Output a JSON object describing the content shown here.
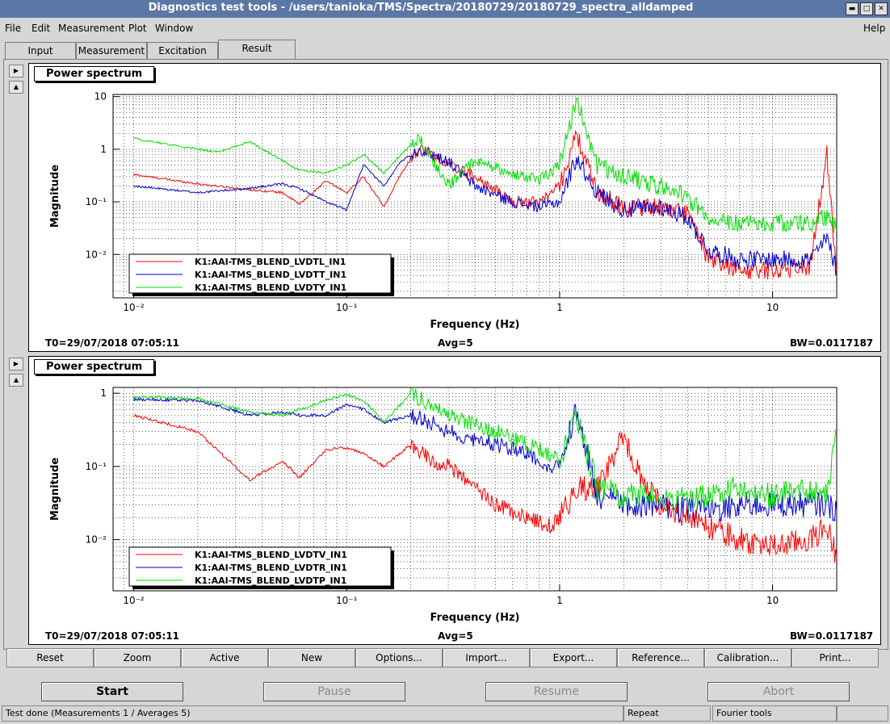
{
  "window": {
    "title": "Diagnostics test tools - /users/tanioka/TMS/Spectra/20180729/20180729_spectra_alldamped"
  },
  "menu": {
    "file": "File",
    "edit": "Edit",
    "measurement": "Measurement",
    "plot": "Plot",
    "window": "Window",
    "help": "Help"
  },
  "tabs": {
    "input": "Input",
    "measurement": "Measurement",
    "excitation": "Excitation",
    "result": "Result"
  },
  "colors": {
    "red": "#ff0000",
    "blue": "#0000cc",
    "green": "#00e000",
    "titlebar": "#5b77a6"
  },
  "panels": [
    {
      "title": "Power spectrum",
      "t0": "T0=29/07/2018 07:05:11",
      "avg": "Avg=5",
      "bw": "BW=0.0117187",
      "ylabel": "Magnitude",
      "xlabel": "Frequency (Hz)",
      "xticks": [
        "10⁻²",
        "10⁻¹",
        "1",
        "10"
      ],
      "yticks": [
        "10",
        "1",
        "10⁻¹",
        "10⁻²"
      ],
      "legend": [
        "K1:AAI-TMS_BLEND_LVDTL_IN1",
        "K1:AAI-TMS_BLEND_LVDTT_IN1",
        "K1:AAI-TMS_BLEND_LVDTY_IN1"
      ]
    },
    {
      "title": "Power spectrum",
      "t0": "T0=29/07/2018 07:05:11",
      "avg": "Avg=5",
      "bw": "BW=0.0117187",
      "ylabel": "Magnitude",
      "xlabel": "Frequency (Hz)",
      "xticks": [
        "10⁻²",
        "10⁻¹",
        "1",
        "10"
      ],
      "yticks": [
        "1",
        "10⁻¹",
        "10⁻²"
      ],
      "legend": [
        "K1:AAI-TMS_BLEND_LVDTV_IN1",
        "K1:AAI-TMS_BLEND_LVDTR_IN1",
        "K1:AAI-TMS_BLEND_LVDTP_IN1"
      ]
    }
  ],
  "chart_data": [
    {
      "type": "line",
      "title": "Power spectrum",
      "xlabel": "Frequency (Hz)",
      "ylabel": "Magnitude",
      "xscale": "log",
      "yscale": "log",
      "xlim": [
        0.008,
        20
      ],
      "ylim": [
        0.0015,
        11
      ],
      "grid": true,
      "legend_position": "bottom-left",
      "series": [
        {
          "name": "K1:AAI-TMS_BLEND_LVDTL_IN1",
          "color": "#ff0000",
          "x": [
            0.01,
            0.02,
            0.035,
            0.05,
            0.06,
            0.08,
            0.1,
            0.12,
            0.15,
            0.18,
            0.22,
            0.3,
            0.4,
            0.6,
            0.8,
            1.0,
            1.2,
            1.5,
            2,
            3,
            4,
            5,
            7,
            10,
            15,
            18,
            20
          ],
          "y": [
            0.33,
            0.22,
            0.17,
            0.15,
            0.09,
            0.25,
            0.15,
            0.3,
            0.08,
            0.35,
            1.1,
            0.5,
            0.3,
            0.1,
            0.1,
            0.2,
            1.9,
            0.15,
            0.08,
            0.08,
            0.06,
            0.008,
            0.005,
            0.005,
            0.006,
            0.8,
            0.004
          ]
        },
        {
          "name": "K1:AAI-TMS_BLEND_LVDTT_IN1",
          "color": "#0000cc",
          "x": [
            0.01,
            0.02,
            0.035,
            0.05,
            0.06,
            0.08,
            0.1,
            0.12,
            0.15,
            0.18,
            0.22,
            0.3,
            0.4,
            0.6,
            0.8,
            1.0,
            1.2,
            1.5,
            2,
            3,
            4,
            5,
            7,
            10,
            15,
            18,
            20
          ],
          "y": [
            0.2,
            0.15,
            0.18,
            0.22,
            0.18,
            0.1,
            0.07,
            0.5,
            0.2,
            0.6,
            1.0,
            0.6,
            0.2,
            0.1,
            0.08,
            0.1,
            0.7,
            0.15,
            0.07,
            0.08,
            0.05,
            0.012,
            0.008,
            0.008,
            0.008,
            0.02,
            0.005
          ]
        },
        {
          "name": "K1:AAI-TMS_BLEND_LVDTY_IN1",
          "color": "#00e000",
          "x": [
            0.01,
            0.02,
            0.025,
            0.035,
            0.05,
            0.06,
            0.08,
            0.1,
            0.12,
            0.15,
            0.18,
            0.22,
            0.3,
            0.4,
            0.6,
            0.8,
            1.0,
            1.2,
            1.5,
            2,
            3,
            4,
            5,
            7,
            10,
            15,
            18,
            20
          ],
          "y": [
            1.6,
            1.0,
            0.9,
            1.4,
            0.6,
            0.4,
            0.35,
            0.5,
            0.8,
            0.35,
            0.8,
            1.6,
            0.2,
            0.6,
            0.35,
            0.25,
            0.5,
            9.0,
            0.5,
            0.3,
            0.2,
            0.12,
            0.05,
            0.04,
            0.04,
            0.04,
            0.05,
            0.03
          ]
        }
      ]
    },
    {
      "type": "line",
      "title": "Power spectrum",
      "xlabel": "Frequency (Hz)",
      "ylabel": "Magnitude",
      "xscale": "log",
      "yscale": "log",
      "xlim": [
        0.008,
        20
      ],
      "ylim": [
        0.002,
        1.2
      ],
      "grid": true,
      "legend_position": "bottom-left",
      "series": [
        {
          "name": "K1:AAI-TMS_BLEND_LVDTV_IN1",
          "color": "#ff0000",
          "x": [
            0.01,
            0.02,
            0.035,
            0.05,
            0.06,
            0.08,
            0.1,
            0.12,
            0.15,
            0.2,
            0.25,
            0.3,
            0.5,
            0.7,
            0.9,
            1.0,
            1.2,
            1.5,
            2,
            2.5,
            3,
            4,
            5,
            7,
            10,
            15,
            18,
            20
          ],
          "y": [
            0.5,
            0.3,
            0.065,
            0.12,
            0.07,
            0.17,
            0.18,
            0.15,
            0.1,
            0.2,
            0.12,
            0.1,
            0.03,
            0.02,
            0.015,
            0.02,
            0.05,
            0.05,
            0.25,
            0.05,
            0.03,
            0.02,
            0.015,
            0.01,
            0.008,
            0.01,
            0.015,
            0.006
          ]
        },
        {
          "name": "K1:AAI-TMS_BLEND_LVDTR_IN1",
          "color": "#0000cc",
          "x": [
            0.01,
            0.02,
            0.035,
            0.05,
            0.06,
            0.08,
            0.1,
            0.12,
            0.15,
            0.2,
            0.25,
            0.3,
            0.5,
            0.7,
            0.9,
            1.0,
            1.2,
            1.5,
            2,
            2.5,
            3,
            4,
            5,
            7,
            10,
            15,
            18,
            20
          ],
          "y": [
            0.82,
            0.8,
            0.5,
            0.55,
            0.5,
            0.5,
            0.7,
            0.6,
            0.4,
            0.5,
            0.4,
            0.3,
            0.2,
            0.15,
            0.1,
            0.1,
            0.6,
            0.04,
            0.03,
            0.03,
            0.03,
            0.025,
            0.025,
            0.03,
            0.03,
            0.03,
            0.03,
            0.025
          ]
        },
        {
          "name": "K1:AAI-TMS_BLEND_LVDTP_IN1",
          "color": "#00e000",
          "x": [
            0.01,
            0.02,
            0.035,
            0.05,
            0.06,
            0.08,
            0.1,
            0.12,
            0.15,
            0.2,
            0.25,
            0.3,
            0.5,
            0.7,
            0.9,
            1.0,
            1.2,
            1.5,
            2,
            2.5,
            3,
            4,
            5,
            7,
            10,
            15,
            18,
            20
          ],
          "y": [
            0.9,
            0.85,
            0.55,
            0.5,
            0.6,
            0.8,
            0.95,
            0.8,
            0.4,
            1.0,
            0.7,
            0.5,
            0.3,
            0.2,
            0.15,
            0.12,
            0.5,
            0.05,
            0.04,
            0.04,
            0.04,
            0.035,
            0.04,
            0.05,
            0.04,
            0.05,
            0.04,
            0.3
          ]
        }
      ]
    }
  ],
  "buttons": {
    "reset": "Reset",
    "zoom": "Zoom",
    "active": "Active",
    "new": "New",
    "options": "Options...",
    "import": "Import...",
    "export": "Export...",
    "reference": "Reference...",
    "calibration": "Calibration...",
    "print": "Print..."
  },
  "controls": {
    "start": "Start",
    "pause": "Pause",
    "resume": "Resume",
    "abort": "Abort"
  },
  "statusbar": {
    "message": "Test done (Measurements 1 / Averages 5)",
    "mode": "Repeat",
    "tool": "Fourier tools"
  }
}
